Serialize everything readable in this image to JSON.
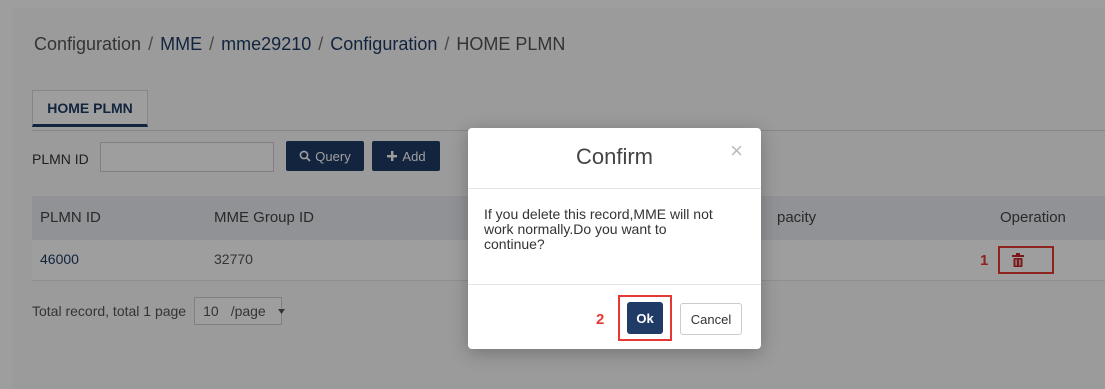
{
  "breadcrumb": {
    "items": [
      "Configuration",
      "MME",
      "mme29210",
      "Configuration",
      "HOME PLMN"
    ],
    "separator": "/"
  },
  "tabs": [
    {
      "label": "HOME PLMN",
      "active": true
    }
  ],
  "filter": {
    "label": "PLMN ID",
    "value": "",
    "placeholder": ""
  },
  "toolbar": {
    "query_label": "Query",
    "add_label": "Add"
  },
  "table": {
    "headers": [
      "PLMN ID",
      "MME Group ID",
      "pacity",
      "Operation"
    ],
    "rows": [
      {
        "plmn_id": "46000",
        "mme_group_id": "32770"
      }
    ]
  },
  "pagination": {
    "summary": "Total record, total 1 page",
    "page_size": "10",
    "per_page_label": "/page"
  },
  "modal": {
    "title": "Confirm",
    "message": "If you delete this record,MME will not work normally.Do you want to continue?",
    "ok_label": "Ok",
    "cancel_label": "Cancel"
  },
  "annotations": {
    "step1": "1",
    "step2": "2"
  },
  "colors": {
    "primary": "#1f3b66",
    "highlight": "#e53935",
    "delete_icon": "#c62828"
  },
  "icons": {
    "query": "search-icon",
    "add": "plus-icon",
    "delete": "trash-icon",
    "close": "close-icon",
    "dropdown": "caret-down-icon"
  }
}
